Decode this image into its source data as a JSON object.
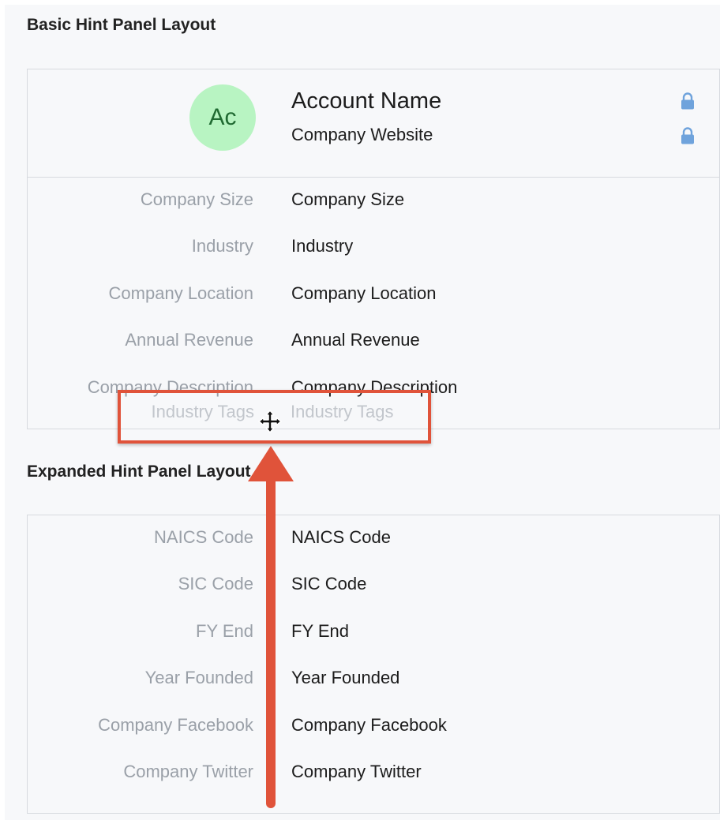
{
  "basic_section": {
    "title": "Basic Hint Panel Layout",
    "avatar_initials": "Ac",
    "account_name": "Account Name",
    "company_website": "Company Website",
    "rows": [
      {
        "label": "Company Size",
        "value": "Company Size"
      },
      {
        "label": "Industry",
        "value": "Industry"
      },
      {
        "label": "Company Location",
        "value": "Company Location"
      },
      {
        "label": "Annual Revenue",
        "value": "Annual Revenue"
      },
      {
        "label": "Company Description",
        "value": "Company Description"
      }
    ],
    "dragged_row": {
      "label": "Industry Tags",
      "value": "Industry Tags"
    }
  },
  "expanded_section": {
    "title": "Expanded Hint Panel Layout",
    "rows": [
      {
        "label": "NAICS Code",
        "value": "NAICS Code"
      },
      {
        "label": "SIC Code",
        "value": "SIC Code"
      },
      {
        "label": "FY End",
        "value": "FY End"
      },
      {
        "label": "Year Founded",
        "value": "Year Founded"
      },
      {
        "label": "Company Facebook",
        "value": "Company Facebook"
      },
      {
        "label": "Company Twitter",
        "value": "Company Twitter"
      }
    ]
  },
  "colors": {
    "avatar_bg": "#b8f4c2",
    "lock_icon": "#6fa3dc",
    "highlight": "#e0533a"
  },
  "icons": [
    "lock-icon",
    "move-cursor-icon",
    "arrow-up"
  ]
}
